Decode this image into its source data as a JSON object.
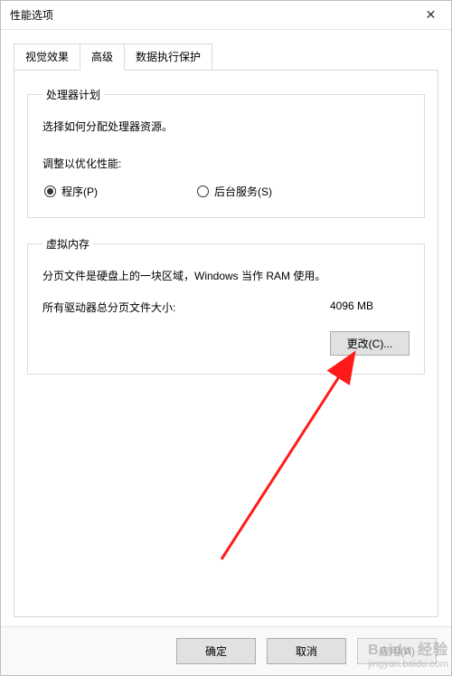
{
  "window": {
    "title": "性能选项"
  },
  "tabs": {
    "visual": "视觉效果",
    "advanced": "高级",
    "dep": "数据执行保护"
  },
  "processor": {
    "legend": "处理器计划",
    "desc": "选择如何分配处理器资源。",
    "optimize_label": "调整以优化性能:",
    "radio_programs": "程序(P)",
    "radio_services": "后台服务(S)"
  },
  "vmem": {
    "legend": "虚拟内存",
    "desc": "分页文件是硬盘上的一块区域，Windows 当作 RAM 使用。",
    "total_label": "所有驱动器总分页文件大小:",
    "total_value": "4096 MB",
    "change_btn": "更改(C)..."
  },
  "footer": {
    "ok": "确定",
    "cancel": "取消",
    "apply": "应用(A)"
  },
  "watermark": {
    "brand": "Baidu 经验",
    "url": "jingyan.baidu.com"
  }
}
